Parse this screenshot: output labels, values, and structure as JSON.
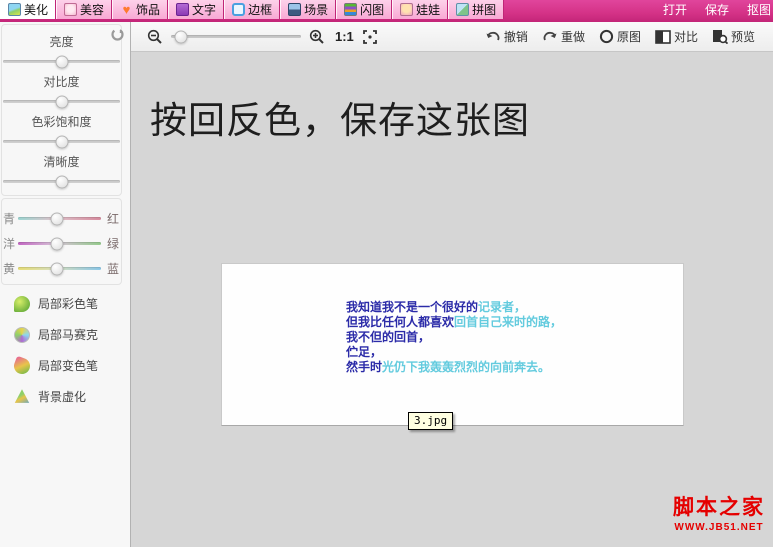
{
  "topbar": {
    "tabs": [
      {
        "label": "美化",
        "active": true
      },
      {
        "label": "美容",
        "active": false
      },
      {
        "label": "饰品",
        "active": false
      },
      {
        "label": "文字",
        "active": false
      },
      {
        "label": "边框",
        "active": false
      },
      {
        "label": "场景",
        "active": false
      },
      {
        "label": "闪图",
        "active": false
      },
      {
        "label": "娃娃",
        "active": false
      },
      {
        "label": "拼图",
        "active": false
      }
    ],
    "actions": {
      "open": "打开",
      "save": "保存",
      "cutout": "抠图"
    }
  },
  "sidebar": {
    "adjust_sliders": [
      {
        "label": "亮度",
        "value": 50
      },
      {
        "label": "对比度",
        "value": 50
      },
      {
        "label": "色彩饱和度",
        "value": 50
      },
      {
        "label": "清晰度",
        "value": 50
      }
    ],
    "color_sliders": [
      {
        "left": "青",
        "right": "红",
        "value": 50
      },
      {
        "left": "洋",
        "right": "绿",
        "value": 50
      },
      {
        "left": "黄",
        "right": "蓝",
        "value": 50
      }
    ],
    "tools": [
      {
        "label": "局部彩色笔"
      },
      {
        "label": "局部马赛克"
      },
      {
        "label": "局部变色笔"
      },
      {
        "label": "背景虚化"
      }
    ]
  },
  "toolbar": {
    "zoom_ratio": "1:1",
    "zoom_percent": 8,
    "undo": "撤销",
    "redo": "重做",
    "original": "原图",
    "compare": "对比",
    "preview": "预览"
  },
  "canvas": {
    "heading": "按回反色，保存这张图",
    "poem": [
      {
        "navy": "我知道我不是一个很好的",
        "cyan": "记录者，"
      },
      {
        "navy": "但我比任何人都喜欢",
        "cyan": "回首自己来时的路，"
      },
      {
        "navy": "我不但的回首，",
        "cyan": ""
      },
      {
        "navy": "伫足，",
        "cyan": ""
      },
      {
        "navy": "然手时",
        "cyan": "光仍下我轰轰烈烈的向前奔去。"
      }
    ],
    "tooltip": "3.jpg"
  },
  "watermark": {
    "title": "脚本之家",
    "url": "WWW.JB51.NET"
  },
  "colors": {
    "topbar_pink": "#d43287",
    "tab_pink": "#f8a9d4",
    "navy_text": "#2b2ba8",
    "cyan_text": "#63cbde",
    "watermark_red": "#e50000",
    "tooltip_bg": "#ffffe1"
  }
}
